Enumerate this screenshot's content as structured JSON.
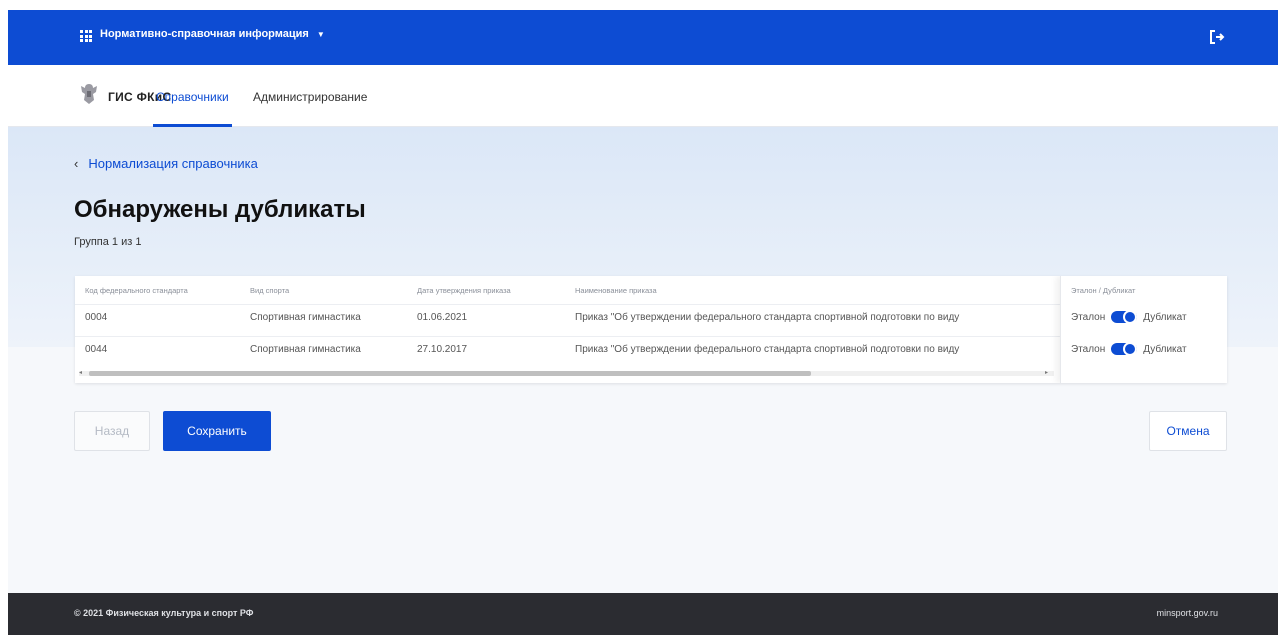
{
  "topbar": {
    "app_switch_label": "Нормативно-справочная информация",
    "accent_color": "#0d4cd3"
  },
  "header": {
    "brand": "ГИС ФКиС",
    "tabs": [
      {
        "label": "Справочники",
        "active": true
      },
      {
        "label": "Администрирование",
        "active": false
      }
    ]
  },
  "breadcrumb": {
    "back_label": "Нормализация справочника"
  },
  "page": {
    "title": "Обнаружены дубликаты",
    "subtitle": "Группа 1 из 1"
  },
  "table": {
    "columns": [
      "Код федерального стандарта",
      "Вид спорта",
      "Дата утверждения приказа",
      "Наименование приказа",
      "Эталон / Дубликат"
    ],
    "rows": [
      {
        "code": "0004",
        "sport": "Спортивная гимнастика",
        "date": "01.06.2021",
        "name": "Приказ \"Об утверждении федерального стандарта спортивной подготовки по виду",
        "left_label": "Эталон",
        "right_label": "Дубликат"
      },
      {
        "code": "0044",
        "sport": "Спортивная гимнастика",
        "date": "27.10.2017",
        "name": "Приказ \"Об утверждении федерального стандарта спортивной подготовки по виду",
        "left_label": "Эталон",
        "right_label": "Дубликат"
      }
    ]
  },
  "buttons": {
    "back": "Назад",
    "save": "Сохранить",
    "cancel": "Отмена"
  },
  "footer": {
    "copyright": "© 2021 Физическая культура и спорт РФ",
    "site": "minsport.gov.ru"
  }
}
